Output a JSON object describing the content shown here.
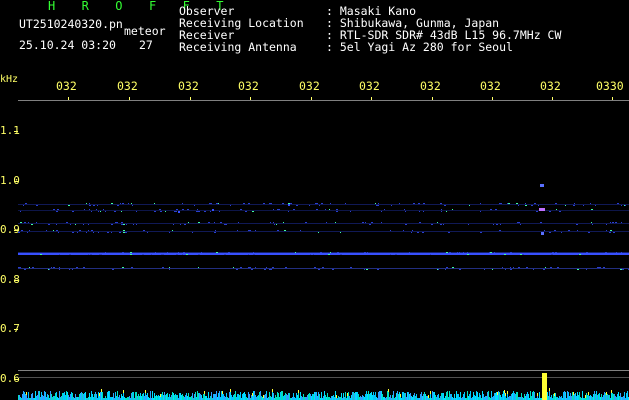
{
  "header": {
    "brand": "H R O F F T",
    "filename": "UT2510240320.pn",
    "mode": "meteor",
    "datetime": "25.10.24 03:20",
    "count": "27",
    "fields": [
      {
        "label": "Observer",
        "value": ": Masaki Kano"
      },
      {
        "label": "Receiving Location",
        "value": ": Shibukawa, Gunma, Japan"
      },
      {
        "label": "Receiver",
        "value": ": RTL-SDR SDR# 43dB L15 96.7MHz CW"
      },
      {
        "label": "Receiving Antenna",
        "value": ": 5el Yagi Az 280 for Seoul"
      }
    ]
  },
  "axis": {
    "unit": "kHz",
    "time_ticks": [
      "032",
      "032",
      "032",
      "032",
      "032",
      "032",
      "032",
      "032",
      "032",
      "0330"
    ],
    "freq_ticks": [
      "1.1",
      "1.0",
      "0.9",
      "0.8",
      "0.7",
      "0.6"
    ]
  },
  "colors": {
    "background": "#000000",
    "header_text": "#ffffff",
    "brand_text": "#33ff33",
    "file_text": "#ffff66",
    "axis_text": "#ffff66",
    "signal": "#4060ff",
    "noise_strip": "#00e0ff",
    "meteor_burst": "#ffff33"
  }
}
